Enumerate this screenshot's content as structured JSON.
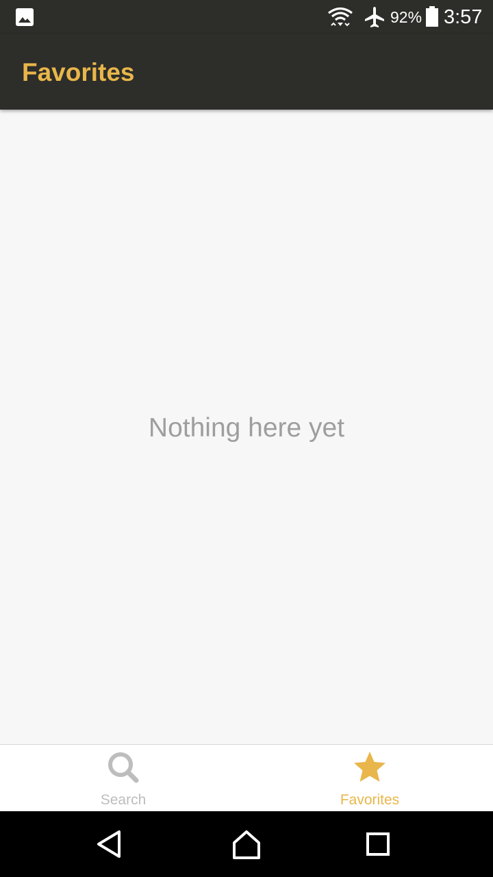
{
  "status_bar": {
    "battery_percent": "92%",
    "time": "3:57",
    "icons": [
      "gallery-icon",
      "wifi-icon",
      "airplane-icon",
      "battery-icon"
    ]
  },
  "app_bar": {
    "title": "Favorites"
  },
  "content": {
    "empty_message": "Nothing here yet"
  },
  "bottom_nav": {
    "items": [
      {
        "label": "Search",
        "icon": "search-icon",
        "active": false
      },
      {
        "label": "Favorites",
        "icon": "star-icon",
        "active": true
      }
    ]
  },
  "system_nav": {
    "buttons": [
      "back-icon",
      "home-icon",
      "recents-icon"
    ]
  },
  "colors": {
    "accent": "#e8b64a",
    "toolbar": "#2d2d2a",
    "background": "#f7f7f7",
    "inactive": "#bdbdbd",
    "empty_text": "#9e9e9e"
  }
}
